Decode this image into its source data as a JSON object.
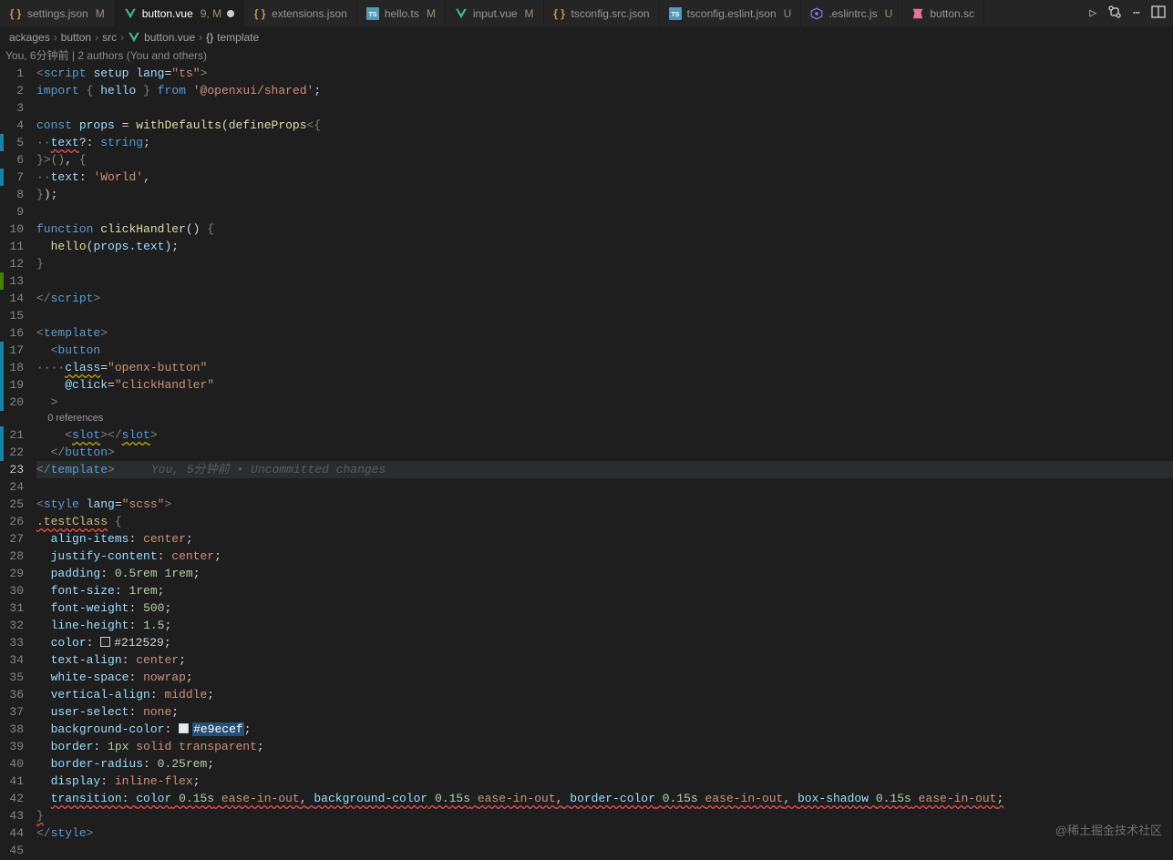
{
  "tabs": [
    {
      "icon": "braces",
      "iconColor": "#c09553",
      "label": "settings.json",
      "status": "M",
      "active": false
    },
    {
      "icon": "vue",
      "iconColor": "#41b883",
      "label": "button.vue",
      "status": "9, M",
      "active": true,
      "dirty": true
    },
    {
      "icon": "braces",
      "iconColor": "#c09553",
      "label": "extensions.json",
      "status": "",
      "active": false
    },
    {
      "icon": "ts",
      "iconColor": "#519aba",
      "label": "hello.ts",
      "status": "M",
      "active": false
    },
    {
      "icon": "vue",
      "iconColor": "#41b883",
      "label": "input.vue",
      "status": "M",
      "active": false
    },
    {
      "icon": "braces",
      "iconColor": "#c09553",
      "label": "tsconfig.src.json",
      "status": "",
      "active": false
    },
    {
      "icon": "ts",
      "iconColor": "#519aba",
      "label": "tsconfig.eslint.json",
      "status": "U",
      "active": false
    },
    {
      "icon": "eslint",
      "iconColor": "#8080f2",
      "label": ".eslintrc.js",
      "status": "U",
      "active": false
    },
    {
      "icon": "stylelint",
      "iconColor": "#e67399",
      "label": "button.sc",
      "status": "",
      "active": false,
      "truncated": true
    }
  ],
  "topActions": {
    "run": "▷",
    "branch": "⎇",
    "more": "⋯"
  },
  "breadcrumb": {
    "parts": [
      "ackages",
      "button",
      "src"
    ],
    "file": "button.vue",
    "symbol": "template",
    "symbolIcon": "{}"
  },
  "blameHeader": "You, 6分钟前 | 2 authors (You and others)",
  "codelens": "0 references",
  "inlineBlame": "You, 5分钟前 • Uncommitted changes",
  "lines": [
    {
      "n": 1,
      "mod": "",
      "html": "<span class='c5'>&lt;</span><span class='c1'>script</span> <span class='c2'>setup</span> <span class='c2'>lang</span><span class='c7'>=</span><span class='c4'>\"ts\"</span><span class='c5'>&gt;</span>"
    },
    {
      "n": 2,
      "mod": "",
      "html": "<span class='c1'>import</span> <span class='c5'>{</span> <span class='c2'>hello</span> <span class='c5'>}</span> <span class='c1'>from</span> <span class='c4'>'@openxui/shared'</span><span class='c7'>;</span>"
    },
    {
      "n": 3,
      "mod": "",
      "html": ""
    },
    {
      "n": 4,
      "mod": "",
      "html": "<span class='c1'>const</span> <span class='c2'>props</span> <span class='c7'>=</span> <span class='c3'>withDefaults</span><span class='c7'>(</span><span class='c3'>defineProps</span><span class='c5'>&lt;</span><span class='c5'>{</span>"
    },
    {
      "n": 5,
      "mod": "mod",
      "html": "<span class='c5'>··</span><span class='wavy-r'><span class='c2'>text</span></span><span class='c7'>?:</span> <span class='c1'>string</span><span class='c7'>;</span>"
    },
    {
      "n": 6,
      "mod": "",
      "html": "<span class='c5'>}&gt;()</span><span class='c7'>,</span> <span class='c5'>{</span>"
    },
    {
      "n": 7,
      "mod": "mod",
      "html": "<span class='c5'>··</span><span class='c2'>text</span><span class='c7'>:</span> <span class='c4'>'World'</span><span class='c7'>,</span>"
    },
    {
      "n": 8,
      "mod": "",
      "html": "<span class='c5'>}</span><span class='c7'>);</span>"
    },
    {
      "n": 9,
      "mod": "",
      "html": ""
    },
    {
      "n": 10,
      "mod": "",
      "html": "<span class='c1'>function</span> <span class='c3'>clickHandler</span><span class='c7'>()</span> <span class='c5'>{</span>"
    },
    {
      "n": 11,
      "mod": "",
      "html": "  <span class='c3'>hello</span><span class='c7'>(</span><span class='c2'>props</span><span class='c7'>.</span><span class='c2'>text</span><span class='c7'>);</span>"
    },
    {
      "n": 12,
      "mod": "",
      "html": "<span class='c5'>}</span>"
    },
    {
      "n": 13,
      "mod": "add",
      "html": ""
    },
    {
      "n": 14,
      "mod": "",
      "html": "<span class='c5'>&lt;/</span><span class='c1'>script</span><span class='c5'>&gt;</span>"
    },
    {
      "n": 15,
      "mod": "",
      "html": ""
    },
    {
      "n": 16,
      "mod": "",
      "html": "<span class='c5'>&lt;</span><span class='c1'>template</span><span class='c5'>&gt;</span>"
    },
    {
      "n": 17,
      "mod": "mod",
      "html": "  <span class='c5'>&lt;</span><span class='c1'>button</span>"
    },
    {
      "n": 18,
      "mod": "mod",
      "html": "<span class='c5'>····</span><span class='wavy-y'><span class='c2'>class</span></span><span class='c7'>=</span><span class='c4'>\"openx-button\"</span>"
    },
    {
      "n": 19,
      "mod": "mod",
      "html": "    <span class='c2'>@click</span><span class='c7'>=</span><span class='c4'>\"clickHandler\"</span>"
    },
    {
      "n": 20,
      "mod": "mod",
      "html": "  <span class='c5'>&gt;</span>"
    },
    {
      "n": 21,
      "mod": "mod",
      "html": "    <span class='c5'>&lt;</span><span class='wavy-y'><span class='c1'>slot</span></span><span class='c5'>&gt;&lt;/</span><span class='wavy-y'><span class='c1'>slot</span></span><span class='c5'>&gt;</span>",
      "codelensBefore": true
    },
    {
      "n": 22,
      "mod": "mod",
      "html": "  <span class='c5'>&lt;/</span><span class='c1'>button</span><span class='c5'>&gt;</span>"
    },
    {
      "n": 23,
      "mod": "",
      "current": true,
      "html": "<span class='c5'>&lt;/</span><span class='c1'>template</span><span class='c5'>&gt;</span><span class='inline-blame' data-bind='inlineBlame'></span>"
    },
    {
      "n": 24,
      "mod": "",
      "html": ""
    },
    {
      "n": 25,
      "mod": "",
      "html": "<span class='c5'>&lt;</span><span class='c1'>style</span> <span class='c2'>lang</span><span class='c7'>=</span><span class='c4'>\"scss\"</span><span class='c5'>&gt;</span>"
    },
    {
      "n": 26,
      "mod": "",
      "html": "<span class='wavy-r'><span class='c8'>.testClass</span></span> <span class='c5'>{</span>"
    },
    {
      "n": 27,
      "mod": "",
      "html": "  <span class='c2'>align-items</span><span class='c7'>:</span> <span class='c4'>center</span><span class='c7'>;</span>"
    },
    {
      "n": 28,
      "mod": "",
      "html": "  <span class='c2'>justify-content</span><span class='c7'>:</span> <span class='c4'>center</span><span class='c7'>;</span>"
    },
    {
      "n": 29,
      "mod": "",
      "html": "  <span class='c2'>padding</span><span class='c7'>:</span> <span class='c6'>0.5rem</span> <span class='c6'>1rem</span><span class='c7'>;</span>"
    },
    {
      "n": 30,
      "mod": "",
      "html": "  <span class='c2'>font-size</span><span class='c7'>:</span> <span class='c6'>1rem</span><span class='c7'>;</span>"
    },
    {
      "n": 31,
      "mod": "",
      "html": "  <span class='c2'>font-weight</span><span class='c7'>:</span> <span class='c6'>500</span><span class='c7'>;</span>"
    },
    {
      "n": 32,
      "mod": "",
      "html": "  <span class='c2'>line-height</span><span class='c7'>:</span> <span class='c6'>1.5</span><span class='c7'>;</span>"
    },
    {
      "n": 33,
      "mod": "",
      "html": "  <span class='c2'>color</span><span class='c7'>:</span> <span class='swatch' style='background:#212529'></span><span class='c7'>#212529;</span>"
    },
    {
      "n": 34,
      "mod": "",
      "html": "  <span class='c2'>text-align</span><span class='c7'>:</span> <span class='c4'>center</span><span class='c7'>;</span>"
    },
    {
      "n": 35,
      "mod": "",
      "html": "  <span class='c2'>white-space</span><span class='c7'>:</span> <span class='c4'>nowrap</span><span class='c7'>;</span>"
    },
    {
      "n": 36,
      "mod": "",
      "html": "  <span class='c2'>vertical-align</span><span class='c7'>:</span> <span class='c4'>middle</span><span class='c7'>;</span>"
    },
    {
      "n": 37,
      "mod": "",
      "html": "  <span class='c2'>user-select</span><span class='c7'>:</span> <span class='c4'>none</span><span class='c7'>;</span>"
    },
    {
      "n": 38,
      "mod": "",
      "html": "  <span class='c2'>background-color</span><span class='c7'>:</span> <span class='swatch' style='background:#e9ecef'></span><span class='sel'>#e9ecef</span><span class='c7'>;</span>"
    },
    {
      "n": 39,
      "mod": "",
      "html": "  <span class='c2'>border</span><span class='c7'>:</span> <span class='c6'>1px</span> <span class='c4'>solid</span> <span class='c4'>transparent</span><span class='c7'>;</span>"
    },
    {
      "n": 40,
      "mod": "",
      "html": "  <span class='c2'>border-radius</span><span class='c7'>:</span> <span class='c6'>0.25rem</span><span class='c7'>;</span>"
    },
    {
      "n": 41,
      "mod": "",
      "html": "  <span class='c2'>display</span><span class='c7'>:</span> <span class='c4'>inline-flex</span><span class='c7'>;</span>"
    },
    {
      "n": 42,
      "mod": "",
      "html": "  <span class='wavy-r'><span class='c2'>transition</span><span class='c7'>:</span> <span class='c2'>color</span> <span class='c6'>0.15s</span> <span class='c4'>ease-in-out</span><span class='c7'>,</span> <span class='c2'>background-color</span> <span class='c6'>0.15s</span> <span class='c4'>ease-in-out</span><span class='c7'>,</span> <span class='c2'>border-color</span> <span class='c6'>0.15s</span> <span class='c4'>ease-in-out</span><span class='c7'>,</span> <span class='c2'>box-shadow</span> <span class='c6'>0.15s</span> <span class='c4'>ease-in-out</span><span class='c7'>;</span></span>"
    },
    {
      "n": 43,
      "mod": "",
      "html": "<span class='wavy-r'><span class='c5'>}</span></span>"
    },
    {
      "n": 44,
      "mod": "",
      "html": "<span class='c5'>&lt;/</span><span class='c1'>style</span><span class='c5'>&gt;</span>"
    },
    {
      "n": 45,
      "mod": "",
      "html": ""
    }
  ],
  "watermark": "@稀土掘金技术社区"
}
